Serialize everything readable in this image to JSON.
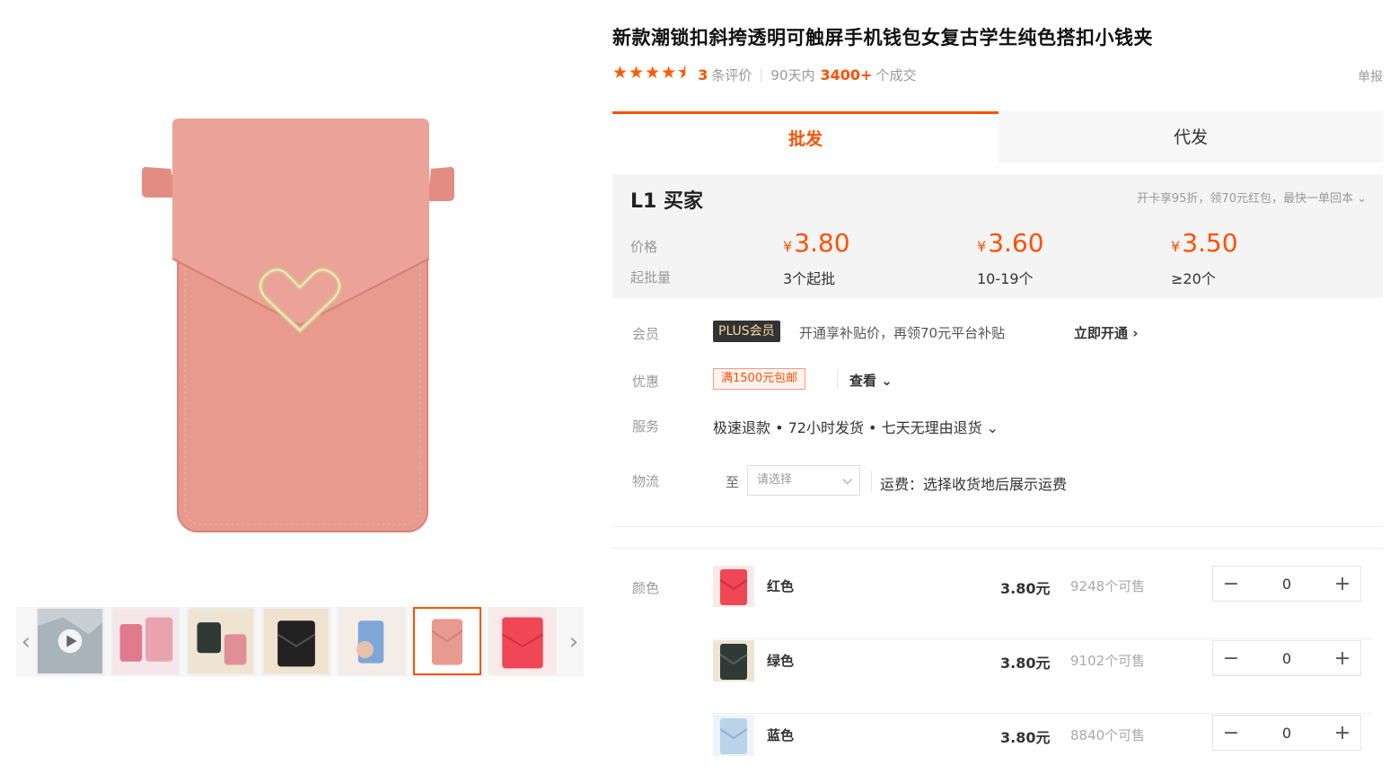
{
  "product": {
    "title": "新款潮锁扣斜挎透明可触屏手机钱包女复古学生纯色搭扣小钱夹"
  },
  "rating": {
    "stars": "★★★★⯨",
    "review_count": "3",
    "review_label": "条评价",
    "sep": "|",
    "period": "90天内",
    "sales": "3400+",
    "sales_label": "个成交",
    "report": "单报"
  },
  "tabs": [
    {
      "label": "批发"
    },
    {
      "label": "代发"
    }
  ],
  "price_box": {
    "level": "L1 买家",
    "note": "开卡享95折，领70元红包，最快一单回本 ⌄",
    "price_label": "价格",
    "qty_label": "起批量",
    "currency": "¥",
    "tiers": [
      {
        "price": "3.80",
        "qty": "3个起批"
      },
      {
        "price": "3.60",
        "qty": "10-19个"
      },
      {
        "price": "3.50",
        "qty": "≥20个"
      }
    ]
  },
  "member": {
    "label": "会员",
    "badge": "PLUS会员",
    "text": "开通享补贴价，再领70元平台补贴",
    "link": "立即开通 ›"
  },
  "promo": {
    "label": "优惠",
    "coupon": "满1500元包邮",
    "view": "查看 ⌄"
  },
  "service": {
    "label": "服务",
    "text": "极速退款 • 72小时发货 • 七天无理由退货 ⌄"
  },
  "logistics": {
    "label": "物流",
    "to": "至",
    "select_placeholder": "请选择",
    "caret": "⌵",
    "shipping": "运费：选择收货地后展示运费"
  },
  "colors": {
    "label": "颜色",
    "items": [
      {
        "name": "红色",
        "price": "3.80元",
        "stock": "9248个可售",
        "qty": "0",
        "swatch": "#f04656"
      },
      {
        "name": "绿色",
        "price": "3.80元",
        "stock": "9102个可售",
        "qty": "0",
        "swatch": "#2f3a36"
      },
      {
        "name": "蓝色",
        "price": "3.80元",
        "stock": "8840个可售",
        "qty": "0",
        "swatch": "#b9d4ea"
      }
    ],
    "minus": "−",
    "plus": "+"
  },
  "gallery": {
    "prev": "‹",
    "next": "›",
    "main_color": "#e99b90"
  }
}
